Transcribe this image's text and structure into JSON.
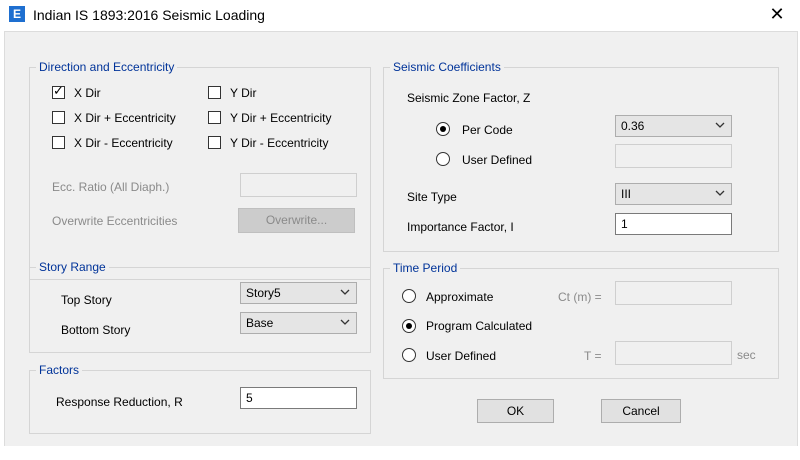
{
  "window": {
    "app_icon_letter": "E",
    "title": "Indian IS 1893:2016 Seismic Loading",
    "close_glyph": "✕"
  },
  "direction": {
    "title": "Direction and Eccentricity",
    "checkboxes": [
      {
        "label": "X Dir",
        "checked": true
      },
      {
        "label": "X Dir + Eccentricity",
        "checked": false
      },
      {
        "label": "X Dir - Eccentricity",
        "checked": false
      },
      {
        "label": "Y Dir",
        "checked": false
      },
      {
        "label": "Y Dir + Eccentricity",
        "checked": false
      },
      {
        "label": "Y Dir - Eccentricity",
        "checked": false
      }
    ],
    "ecc_ratio_label": "Ecc. Ratio (All Diaph.)",
    "ecc_ratio_value": "",
    "overwrite_label": "Overwrite Eccentricities",
    "overwrite_button": "Overwrite..."
  },
  "story_range": {
    "title": "Story Range",
    "top_label": "Top Story",
    "top_value": "Story5",
    "bottom_label": "Bottom Story",
    "bottom_value": "Base"
  },
  "factors": {
    "title": "Factors",
    "response_label": "Response Reduction, R",
    "response_value": "5"
  },
  "seismic": {
    "title": "Seismic Coefficients",
    "zone_label": "Seismic Zone Factor, Z",
    "per_code_label": "Per Code",
    "per_code_selected": true,
    "zone_value": "0.36",
    "user_defined_label": "User Defined",
    "user_defined_value": "",
    "site_type_label": "Site Type",
    "site_type_value": "III",
    "importance_label": "Importance Factor, I",
    "importance_value": "1"
  },
  "time_period": {
    "title": "Time Period",
    "approximate_label": "Approximate",
    "ct_label": "Ct (m) =",
    "ct_value": "",
    "program_label": "Program Calculated",
    "program_selected": true,
    "user_label": "User Defined",
    "t_label": "T =",
    "t_value": "",
    "sec_label": "sec"
  },
  "buttons": {
    "ok": "OK",
    "cancel": "Cancel"
  }
}
